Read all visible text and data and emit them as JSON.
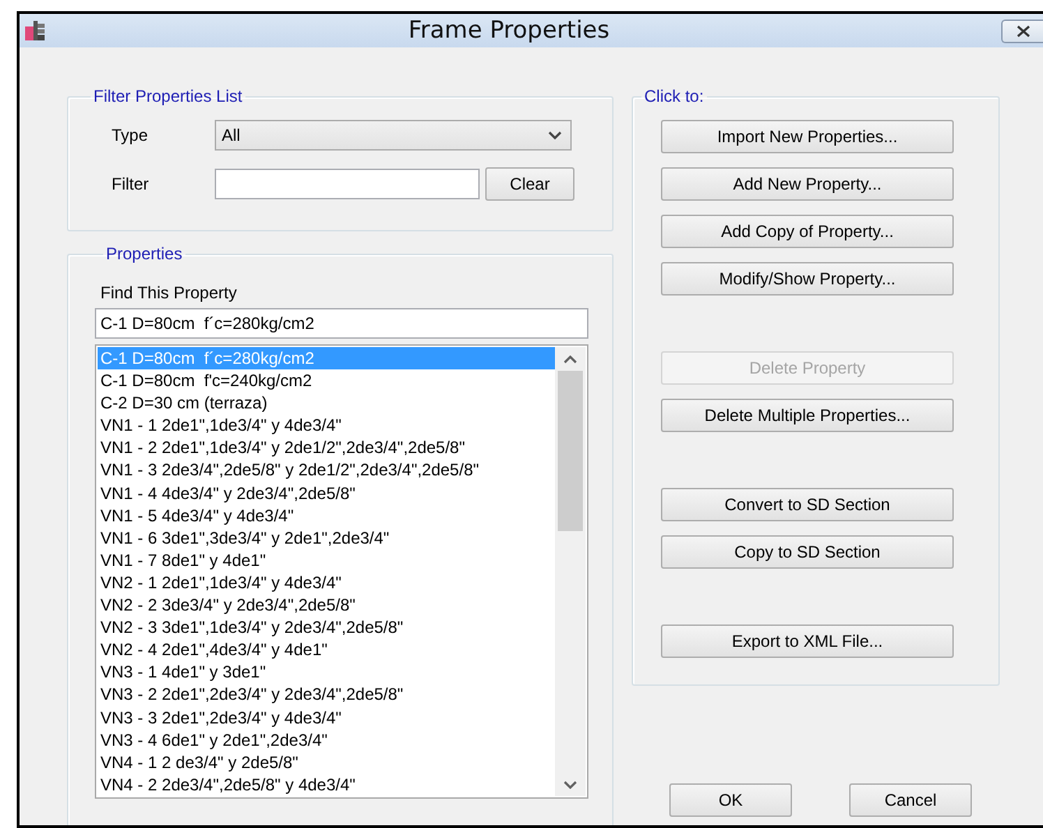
{
  "window": {
    "title": "Frame Properties"
  },
  "filter_group": {
    "title": "Filter Properties List",
    "type_label": "Type",
    "type_value": "All",
    "filter_label": "Filter",
    "clear_button": "Clear"
  },
  "properties_group": {
    "title": "Properties",
    "find_label": "Find This Property",
    "find_value": "C-1 D=80cm  f´c=280kg/cm2",
    "items": [
      {
        "label": "C-1 D=80cm  f´c=280kg/cm2",
        "selected": true
      },
      {
        "label": "C-1 D=80cm  f'c=240kg/cm2",
        "selected": false
      },
      {
        "label": "C-2 D=30 cm (terraza)",
        "selected": false
      },
      {
        "label": "VN1 - 1 2de1\",1de3/4\" y 4de3/4\"",
        "selected": false
      },
      {
        "label": "VN1 - 2 2de1\",1de3/4\" y 2de1/2\",2de3/4\",2de5/8\"",
        "selected": false
      },
      {
        "label": "VN1 - 3 2de3/4\",2de5/8\" y 2de1/2\",2de3/4\",2de5/8\"",
        "selected": false
      },
      {
        "label": "VN1 - 4 4de3/4\" y 2de3/4\",2de5/8\"",
        "selected": false
      },
      {
        "label": "VN1 - 5 4de3/4\" y 4de3/4\"",
        "selected": false
      },
      {
        "label": "VN1 - 6 3de1\",3de3/4\" y 2de1\",2de3/4\"",
        "selected": false
      },
      {
        "label": "VN1 - 7 8de1\" y 4de1\"",
        "selected": false
      },
      {
        "label": "VN2 - 1 2de1\",1de3/4\" y 4de3/4\"",
        "selected": false
      },
      {
        "label": "VN2 - 2 3de3/4\" y 2de3/4\",2de5/8\"",
        "selected": false
      },
      {
        "label": "VN2 - 3 3de1\",1de3/4\" y 2de3/4\",2de5/8\"",
        "selected": false
      },
      {
        "label": "VN2 - 4 2de1\",4de3/4\" y 4de1\"",
        "selected": false
      },
      {
        "label": "VN3 - 1 4de1\" y 3de1\"",
        "selected": false
      },
      {
        "label": "VN3 - 2 2de1\",2de3/4\" y 2de3/4\",2de5/8\"",
        "selected": false
      },
      {
        "label": "VN3 - 3 2de1\",2de3/4\" y 4de3/4\"",
        "selected": false
      },
      {
        "label": "VN3 - 4 6de1\" y 2de1\",2de3/4\"",
        "selected": false
      },
      {
        "label": "VN4 - 1 2 de3/4\" y 2de5/8\"",
        "selected": false
      },
      {
        "label": "VN4 - 2 2de3/4\",2de5/8\" y 4de3/4\"",
        "selected": false
      }
    ]
  },
  "actions_group": {
    "title": "Click to:",
    "button_groups": [
      [
        {
          "label": "Import New Properties...",
          "disabled": false
        },
        {
          "label": "Add New Property...",
          "disabled": false
        },
        {
          "label": "Add Copy of Property...",
          "disabled": false
        },
        {
          "label": "Modify/Show Property...",
          "disabled": false
        }
      ],
      [
        {
          "label": "Delete Property",
          "disabled": true
        },
        {
          "label": "Delete Multiple Properties...",
          "disabled": false
        }
      ],
      [
        {
          "label": "Convert to SD Section",
          "disabled": false
        },
        {
          "label": "Copy to SD Section",
          "disabled": false
        }
      ],
      [
        {
          "label": "Export to XML File...",
          "disabled": false
        }
      ]
    ]
  },
  "footer_buttons": [
    "OK",
    "Cancel"
  ]
}
